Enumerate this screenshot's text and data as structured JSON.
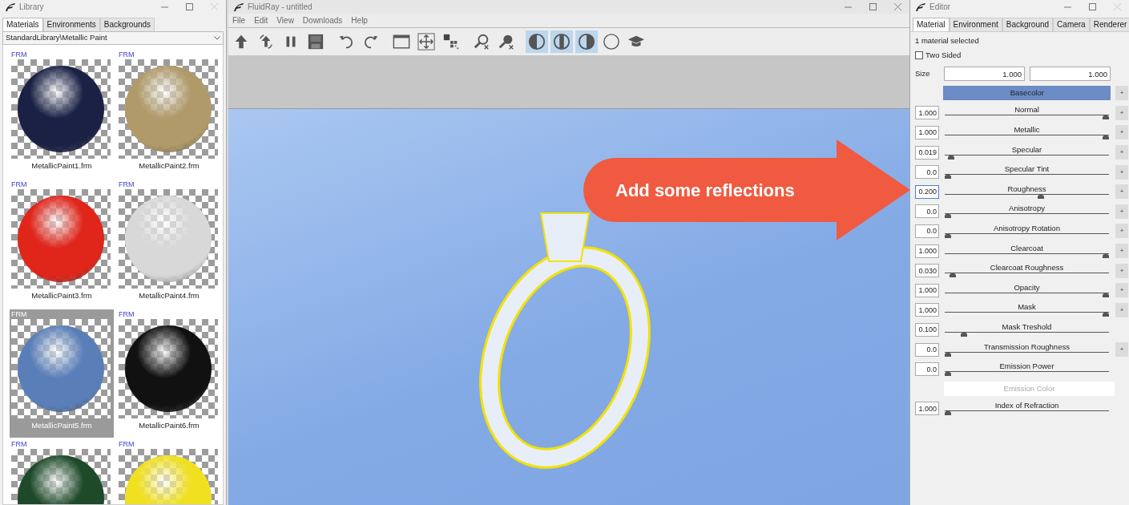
{
  "library": {
    "title": "Library",
    "tabs": [
      {
        "label": "Materials",
        "selected": true
      },
      {
        "label": "Environments",
        "selected": false
      },
      {
        "label": "Backgrounds",
        "selected": false
      }
    ],
    "path": "StandardLibrary\\Metallic Paint",
    "materials": [
      {
        "tag": "FRM",
        "name": "MetallicPaint1.frm",
        "color": "#1a2145",
        "selected": false
      },
      {
        "tag": "FRM",
        "name": "MetallicPaint2.frm",
        "color": "#b09a6a",
        "selected": false
      },
      {
        "tag": "FRM",
        "name": "MetallicPaint3.frm",
        "color": "#e0251a",
        "selected": false
      },
      {
        "tag": "FRM",
        "name": "MetallicPaint4.frm",
        "color": "#d8d8d8",
        "selected": false
      },
      {
        "tag": "FRM",
        "name": "MetallicPaint5.frm",
        "color": "#5a7fb8",
        "selected": true
      },
      {
        "tag": "FRM",
        "name": "MetallicPaint6.frm",
        "color": "#111111",
        "selected": false
      },
      {
        "tag": "FRM",
        "color": "#1e4a2a",
        "selected": false
      },
      {
        "tag": "FRM",
        "color": "#f0e020",
        "selected": false
      }
    ]
  },
  "main": {
    "title": "FluidRay - untitled",
    "menu": [
      "File",
      "Edit",
      "View",
      "Downloads",
      "Help"
    ],
    "toolbar": [
      {
        "kind": "upload",
        "selected": false
      },
      {
        "kind": "reload",
        "selected": false
      },
      {
        "kind": "pause",
        "selected": false
      },
      {
        "kind": "save",
        "selected": false
      },
      {
        "kind": "undo",
        "selected": false
      },
      {
        "kind": "redo",
        "selected": false
      },
      {
        "kind": "window",
        "selected": false
      },
      {
        "kind": "move",
        "selected": false
      },
      {
        "kind": "pixels",
        "selected": false
      },
      {
        "kind": "zoom-clear",
        "selected": false
      },
      {
        "kind": "pick-clear",
        "selected": false
      },
      {
        "kind": "shade-left",
        "selected": true
      },
      {
        "kind": "shade-center",
        "selected": true
      },
      {
        "kind": "shade-right",
        "selected": true
      },
      {
        "kind": "shade-none",
        "selected": false
      },
      {
        "kind": "learn",
        "selected": false
      }
    ],
    "callout": "Add some reflections"
  },
  "editor": {
    "title": "Editor",
    "tabs": [
      {
        "label": "Material",
        "selected": true
      },
      {
        "label": "Environment",
        "selected": false
      },
      {
        "label": "Background",
        "selected": false
      },
      {
        "label": "Camera",
        "selected": false
      },
      {
        "label": "Renderer",
        "selected": false
      }
    ],
    "status": "1 material selected",
    "two_sided": {
      "label": "Two Sided",
      "checked": false
    },
    "size": {
      "label": "Size",
      "values": [
        "1.000",
        "1.000"
      ]
    },
    "rows": [
      {
        "kind": "color",
        "label": "Basecolor",
        "active": true,
        "add": "+"
      },
      {
        "kind": "slider",
        "label": "Normal",
        "value": "1.000",
        "level": 1,
        "focused": false,
        "add": "+"
      },
      {
        "kind": "slider",
        "label": "Metallic",
        "value": "1.000",
        "level": 1,
        "focused": false,
        "add": "+"
      },
      {
        "kind": "slider",
        "label": "Specular",
        "value": "0.019",
        "level": 0.019,
        "focused": false,
        "add": "+"
      },
      {
        "kind": "slider",
        "label": "Specular Tint",
        "value": "0.0",
        "level": 0,
        "focused": false,
        "add": "+"
      },
      {
        "kind": "slider",
        "label": "Roughness",
        "value": "0.200",
        "level": 0.59,
        "focused": true,
        "add": "+"
      },
      {
        "kind": "slider",
        "label": "Anisotropy",
        "value": "0.0",
        "level": 0,
        "focused": false,
        "add": "+"
      },
      {
        "kind": "slider",
        "label": "Anisotropy Rotation",
        "value": "0.0",
        "level": 0,
        "focused": false,
        "add": "+"
      },
      {
        "kind": "slider",
        "label": "Clearcoat",
        "value": "1.000",
        "level": 1,
        "focused": false,
        "add": "+"
      },
      {
        "kind": "slider",
        "label": "Clearcoat Roughness",
        "value": "0.030",
        "level": 0.03,
        "focused": false,
        "add": "+"
      },
      {
        "kind": "slider",
        "label": "Opacity",
        "value": "1.000",
        "level": 1,
        "focused": false,
        "add": "+"
      },
      {
        "kind": "slider",
        "label": "Mask",
        "value": "1.000",
        "level": 1,
        "focused": false,
        "add": "+"
      },
      {
        "kind": "slider",
        "label": "Mask Treshold",
        "value": "0.100",
        "level": 0.1,
        "focused": false
      },
      {
        "kind": "slider",
        "label": "Transmission Roughness",
        "value": "0.0",
        "level": 0,
        "focused": false,
        "add": "+"
      },
      {
        "kind": "slider",
        "label": "Emission Power",
        "value": "0.0",
        "level": 0,
        "focused": false
      },
      {
        "kind": "color",
        "label": "Emission Color",
        "active": false
      },
      {
        "kind": "slider",
        "label": "Index of Refraction",
        "value": "1.000",
        "level": 0,
        "focused": false
      }
    ]
  }
}
